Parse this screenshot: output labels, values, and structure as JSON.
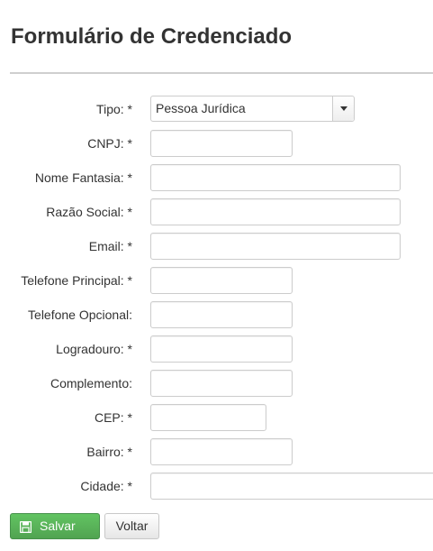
{
  "page": {
    "title": "Formulário de Credenciado"
  },
  "form": {
    "tipo": {
      "label": "Tipo: *",
      "selected": "Pessoa Jurídica"
    },
    "cnpj": {
      "label": "CNPJ: *",
      "value": ""
    },
    "nome_fantasia": {
      "label": "Nome Fantasia: *",
      "value": ""
    },
    "razao_social": {
      "label": "Razão Social: *",
      "value": ""
    },
    "email": {
      "label": "Email: *",
      "value": ""
    },
    "telefone_principal": {
      "label": "Telefone Principal: *",
      "value": ""
    },
    "telefone_opcional": {
      "label": "Telefone Opcional:",
      "value": ""
    },
    "logradouro": {
      "label": "Logradouro: *",
      "value": ""
    },
    "complemento": {
      "label": "Complemento:",
      "value": ""
    },
    "cep": {
      "label": "CEP: *",
      "value": ""
    },
    "bairro": {
      "label": "Bairro: *",
      "value": ""
    },
    "cidade": {
      "label": "Cidade: *",
      "value": ""
    }
  },
  "actions": {
    "save_label": "Salvar",
    "save_icon": "floppy-disk-icon",
    "back_label": "Voltar"
  },
  "colors": {
    "save_button": "#5bb75b",
    "text": "#333333",
    "border": "#cccccc"
  }
}
